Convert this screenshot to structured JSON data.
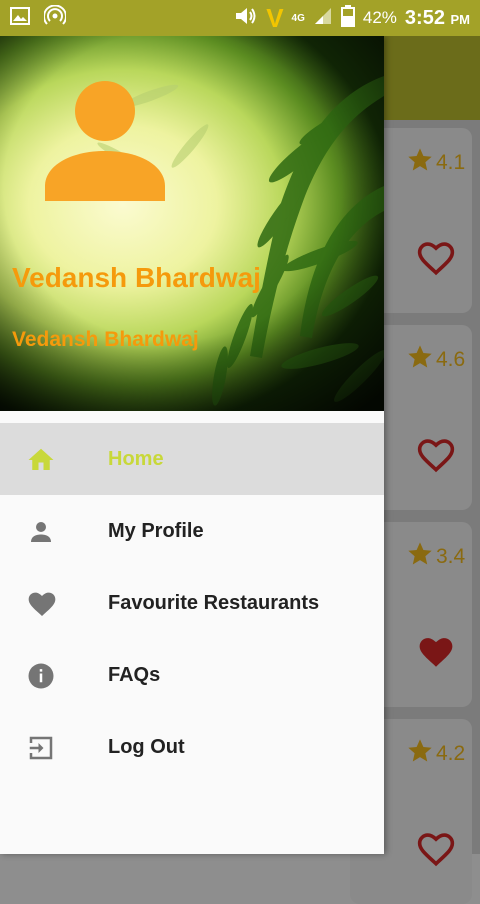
{
  "status_bar": {
    "network": "4G",
    "battery_percent": "42%",
    "time": "3:52",
    "ampm": "PM"
  },
  "drawer": {
    "user_name": "Vedansh Bhardwaj",
    "user_subtitle": "Vedansh Bhardwaj",
    "menu": [
      {
        "label": "Home",
        "icon": "home-icon",
        "active": true
      },
      {
        "label": "My Profile",
        "icon": "person-icon",
        "active": false
      },
      {
        "label": "Favourite Restaurants",
        "icon": "heart-icon",
        "active": false
      },
      {
        "label": "FAQs",
        "icon": "info-icon",
        "active": false
      },
      {
        "label": "Log Out",
        "icon": "logout-icon",
        "active": false
      }
    ]
  },
  "restaurants": [
    {
      "rating": "4.1",
      "favourite": false
    },
    {
      "rating": "4.6",
      "favourite": false
    },
    {
      "rating": "3.4",
      "favourite": true
    },
    {
      "rating": "4.2",
      "favourite": false
    }
  ],
  "colors": {
    "accent": "#a3a228",
    "name_orange": "#f59a0c",
    "active_menu": "#c8d83a",
    "heart_red": "#c62828"
  }
}
